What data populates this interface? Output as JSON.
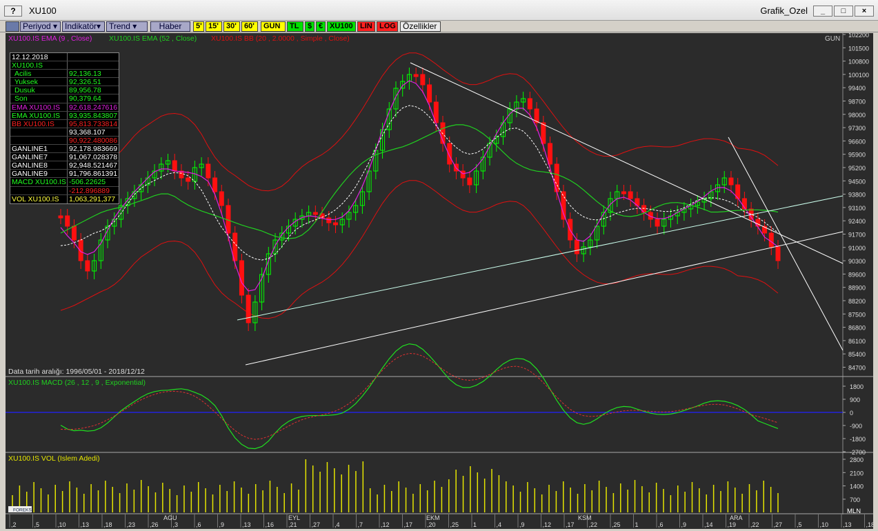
{
  "window": {
    "help_label": "?",
    "title": "XU100",
    "right_title": "Grafik_Ozel",
    "min_label": "_",
    "max_label": "□",
    "close_label": "×"
  },
  "toolbar": {
    "periyod": "Periyod",
    "indikator": "Indikatör",
    "trend": "Trend",
    "haber": "Haber",
    "p5": "5'",
    "p15": "15'",
    "p30": "30'",
    "p60": "60'",
    "gun": "GUN",
    "tl": "TL",
    "usd": "$",
    "eur": "€",
    "xu100": "XU100",
    "lin": "LIN",
    "log": "LOG",
    "ozellikler": "Özellikler"
  },
  "main_panel": {
    "legend_ema9": "XU100.IS EMA (9 , Close)",
    "legend_ema52": "XU100.IS EMA (52 , Close)",
    "legend_bb": "XU100.IS BB (20 , 2.0000 , Simple , Close)",
    "period_label": "GUN",
    "date_range": "Data tarih aralığı: 1996/05/01 - 2018/12/12",
    "y_ticks": [
      "102200",
      "101500",
      "100800",
      "100100",
      "99400",
      "98700",
      "98000",
      "97300",
      "96600",
      "95900",
      "95200",
      "94500",
      "93800",
      "93100",
      "92400",
      "91700",
      "91000",
      "90300",
      "89600",
      "88900",
      "88200",
      "87500",
      "86800",
      "86100",
      "85400",
      "84700"
    ],
    "colors": {
      "ema9": "#e020e0",
      "ema52": "#20d020",
      "bb": "#e01010",
      "up": "#00ff00",
      "down": "#ff1010"
    }
  },
  "infobox": {
    "date": "12.12.2018",
    "symbol": "XU100.IS",
    "acilis_label": "Acilis",
    "acilis": "92,136.13",
    "yuksek_label": "Yuksek",
    "yuksek": "92,326.51",
    "dusuk_label": "Dusuk",
    "dusuk": "89,956.78",
    "son_label": "Son",
    "son": "90,379.64",
    "ema9_label": "EMA XU100.IS",
    "ema9": "92,618.247616",
    "ema52_label": "EMA XU100.IS",
    "ema52": "93,935.843807",
    "bb_label": "BB XU100.IS",
    "bb1": "95,813.733814",
    "bb2": "93,368.107",
    "bb3": "90,922.480086",
    "g1_label": "GANLINE1",
    "g1": "92,178.983669",
    "g7_label": "GANLINE7",
    "g7": "91,067.028378",
    "g8_label": "GANLINE8",
    "g8": "92,948.521467",
    "g9_label": "GANLINE9",
    "g9": "91,796.861391",
    "macd_label": "MACD XU100.IS",
    "macd1": "-506.22625",
    "macd2": "-212.896889",
    "vol_label": "VOL XU100.IS",
    "vol": "1,063,291,377"
  },
  "macd_panel": {
    "legend": "XU100.IS MACD (26 , 12 , 9 , Exponential)",
    "y_ticks": [
      "1800",
      "900",
      "0",
      "-900",
      "-1800",
      "-2700"
    ]
  },
  "vol_panel": {
    "legend": "XU100.IS VOL (Islem Adedi)",
    "y_ticks": [
      "2800",
      "2100",
      "1400",
      "700"
    ],
    "unit": "MLN",
    "logo": "FOREKS"
  },
  "x_axis": {
    "months": [
      "AGU",
      "EYL",
      "EKM",
      "KSM",
      "ARA"
    ],
    "days": [
      ",2",
      ",5",
      ",10",
      ",13",
      ",18",
      ",23",
      ",26",
      ",3",
      ",6",
      ",9",
      ",13",
      ",16",
      ",21",
      ",27",
      ",4",
      ",7",
      ",12",
      ",17",
      ",20",
      ",25",
      "1",
      ",4",
      ",9",
      ",12",
      ",17",
      ",22",
      ",25",
      "1",
      ",6",
      ",9",
      ",14",
      ",19",
      ",22",
      ",27",
      ",5",
      ",10",
      ",13",
      ",18",
      ",21"
    ]
  }
}
